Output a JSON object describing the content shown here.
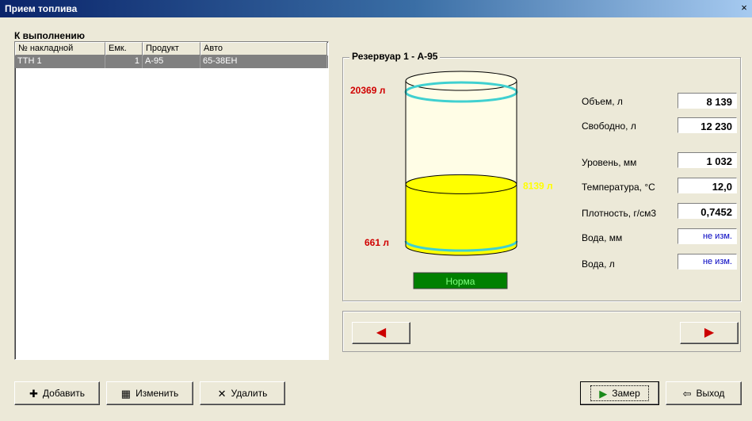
{
  "window": {
    "title": "Прием топлива",
    "close_glyph": "×"
  },
  "queue": {
    "label": "К выполнению",
    "columns": [
      "№ накладной",
      "Емк.",
      "Продукт",
      "Авто"
    ],
    "rows": [
      {
        "invoice": "ТТН 1",
        "tank": "1",
        "product": "А-95",
        "auto": "65-38ЕН"
      }
    ]
  },
  "tank": {
    "title": "Резервуар 1 - А-95",
    "max_label": "20369 л",
    "current_label": "8139 л",
    "min_label": "661 л",
    "status": "Норма",
    "fill_fraction": 0.4,
    "colors": {
      "fuel": "#ffff00",
      "empty": "#fffde6",
      "rim": "#40d0d0",
      "status_bg": "#008000",
      "status_text": "#7fff7f",
      "limit_text": "#d00000",
      "current_text": "#ffff00"
    }
  },
  "params": [
    {
      "label": "Объем, л",
      "value": "8 139",
      "style": "bold"
    },
    {
      "label": "Свободно, л",
      "value": "12 230",
      "style": "bold"
    },
    {
      "label": "Уровень, мм",
      "value": "1 032",
      "style": "bold"
    },
    {
      "label": "Температура, °С",
      "value": "12,0",
      "style": "bold"
    },
    {
      "label": "Плотность, г/см3",
      "value": "0,7452",
      "style": "bold"
    },
    {
      "label": "Вода, мм",
      "value": "не изм.",
      "style": "blue"
    },
    {
      "label": "Вода, л",
      "value": "не изм.",
      "style": "blue"
    }
  ],
  "nav": {
    "prev_icon": "arrow-left-icon",
    "next_icon": "arrow-right-icon",
    "prev_glyph": "◀",
    "next_glyph": "▶"
  },
  "buttons": {
    "add": {
      "label": "Добавить",
      "glyph": "✚"
    },
    "edit": {
      "label": "Изменить",
      "glyph": "▦"
    },
    "delete": {
      "label": "Удалить",
      "glyph": "✕"
    },
    "measure": {
      "label": "Замер",
      "glyph": "▶"
    },
    "exit": {
      "label": "Выход",
      "glyph": "⇦"
    }
  }
}
